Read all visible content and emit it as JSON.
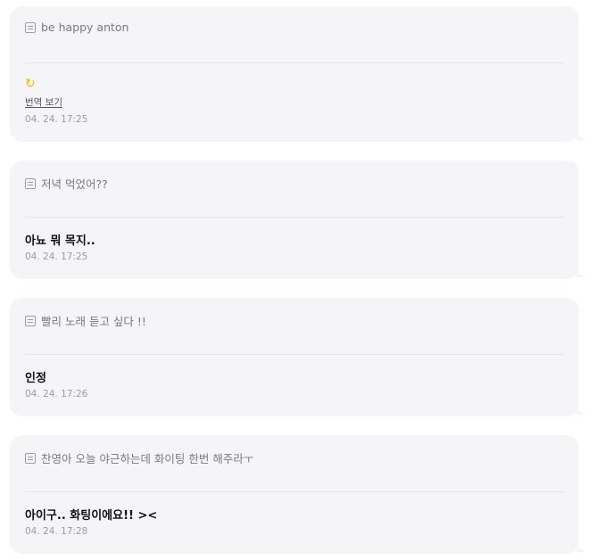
{
  "messages": [
    {
      "quote": "be happy anton",
      "reply_emoji": "↻",
      "translate_label": "번역 보기",
      "time": "04. 24. 17:25"
    },
    {
      "quote": "저녁 먹었어??",
      "reply": "아뇨 뭐 목지..",
      "time": "04. 24. 17:25"
    },
    {
      "quote": "빨리 노래 듣고 싶다 !!",
      "reply": "인정",
      "time": "04. 24. 17:26"
    },
    {
      "quote": "찬영아 오늘 야근하는데 화이팅 한번 해주라ㅜ",
      "reply": "아이구.. 화팅이에요!! ><",
      "time": "04. 24. 17:28"
    }
  ]
}
